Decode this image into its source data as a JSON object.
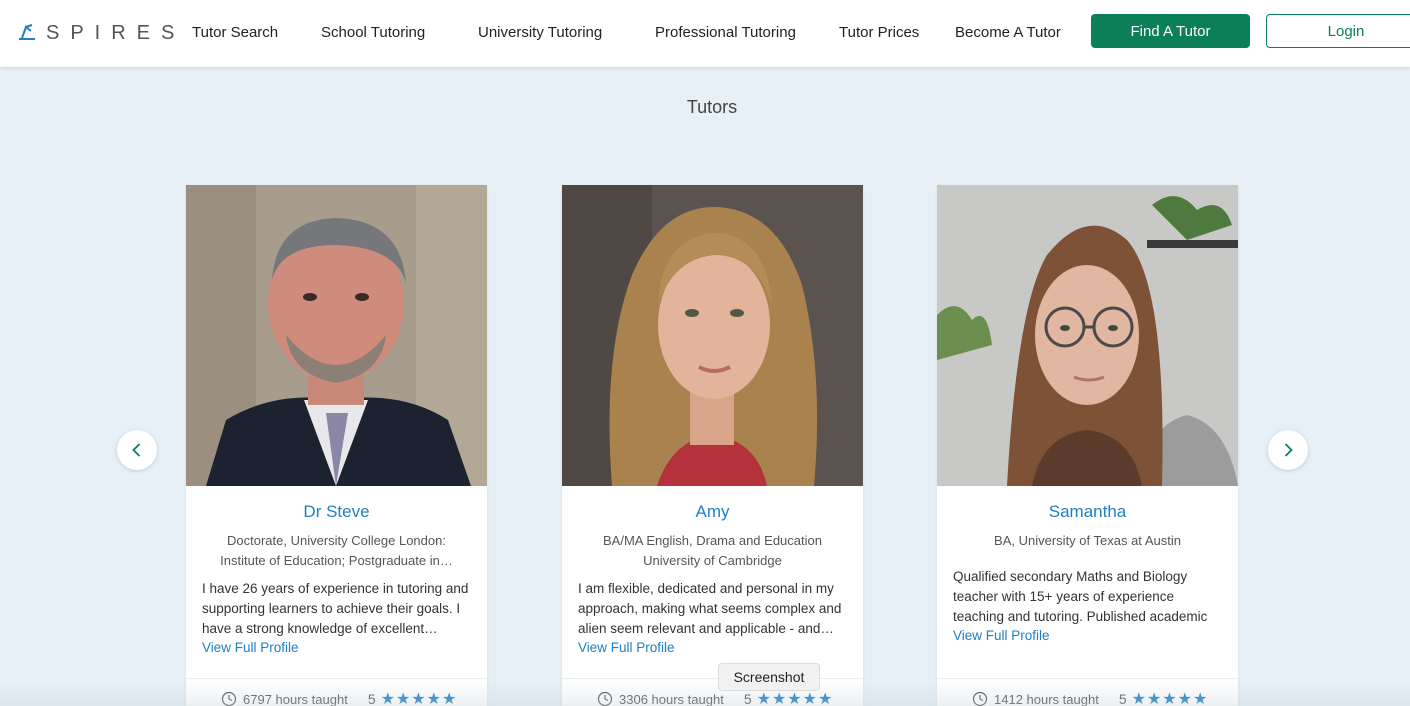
{
  "header": {
    "logo_text": "SPIRES",
    "nav": [
      {
        "label": "Tutor Search"
      },
      {
        "label": "School Tutoring"
      },
      {
        "label": "University Tutoring"
      },
      {
        "label": "Professional Tutoring"
      },
      {
        "label": "Tutor Prices"
      },
      {
        "label": "Become A Tutor"
      }
    ],
    "find_button": "Find A Tutor",
    "login_button": "Login"
  },
  "section": {
    "title": "Tutors"
  },
  "tutors": [
    {
      "name": "Dr Steve",
      "qualification": "Doctorate, University College London: Institute of Education; Postgraduate in…",
      "bio": "I have 26 years of experience in tutoring and supporting learners to achieve their goals. I have a strong knowledge of excellent…",
      "link": "View Full Profile",
      "hours": "6797 hours taught",
      "rating": "5",
      "stars": "★★★★★"
    },
    {
      "name": "Amy",
      "qualification": "BA/MA English, Drama and Education University of Cambridge",
      "bio": "I am flexible, dedicated and personal in my approach, making what seems complex and alien seem relevant and applicable - and…",
      "link": "View Full Profile",
      "hours": "3306 hours taught",
      "rating": "5",
      "stars": "★★★★★"
    },
    {
      "name": "Samantha",
      "qualification": "BA, University of Texas at Austin",
      "bio": "Qualified secondary Maths and Biology teacher with 15+ years of experience teaching and tutoring. Published academic and…",
      "link": "View Full Profile",
      "hours": "1412 hours taught",
      "rating": "5",
      "stars": "★★★★★"
    }
  ],
  "tooltip": {
    "text": "Screenshot"
  },
  "colors": {
    "brand_green": "#0b7f57",
    "link_blue": "#1f7fc2",
    "background": "#e6f0f6"
  }
}
